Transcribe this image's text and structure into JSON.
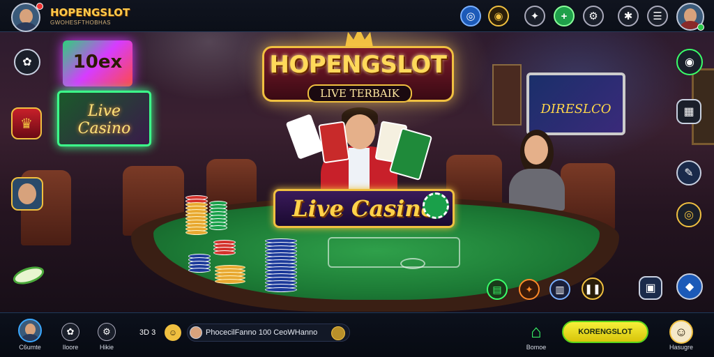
{
  "header": {
    "brand_title": "HOPENGSLOT",
    "brand_subtitle": "GWOHESFTHOBHAS",
    "icons": [
      "user-avatar-icon",
      "wheel-icon",
      "coin-icon",
      "gift-icon",
      "plus-icon",
      "settings-gear-icon",
      "support-icon",
      "menu-icon",
      "profile-avatar-icon"
    ]
  },
  "hero": {
    "logo_title": "HOPENGSLOT",
    "logo_subtitle": "LIVE TERBAIK",
    "banner_text": "Live Casino",
    "sign_left": "Live Casino",
    "sign_top_left": "10ex",
    "sign_right": "DIRESLCO"
  },
  "bottom": {
    "nav": [
      {
        "label": "C6umte",
        "icon": "avatar-icon"
      },
      {
        "label": "Iloore",
        "icon": "gear-icon"
      },
      {
        "label": "Hikie",
        "icon": "settings-icon"
      }
    ],
    "balance_text": "3D 3",
    "ticker_text": "PhocecilFanno 100 CeoWHanno",
    "home_label": "Bomoe",
    "promo_button": "KORENGSLOT",
    "profile_label": "Hasugre"
  },
  "colors": {
    "accent_gold": "#f0c040",
    "felt_green": "#1c7a35",
    "promo_yellow": "#f7f03a"
  }
}
